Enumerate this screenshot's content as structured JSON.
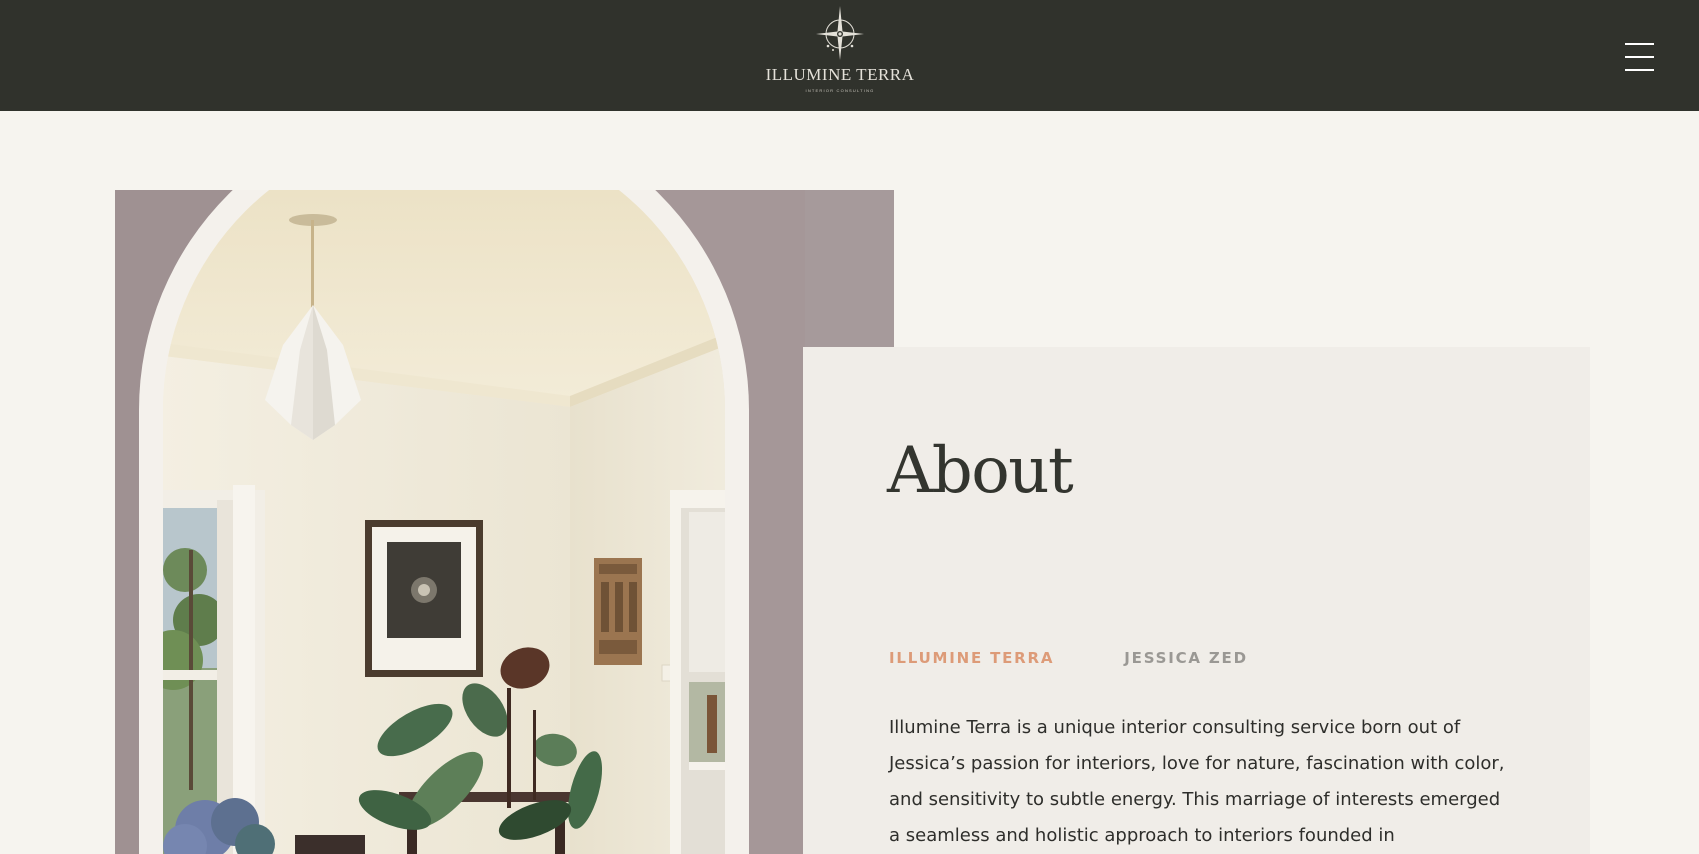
{
  "header": {
    "logo_name": "ILLUMINE TERRA",
    "logo_tagline": "INTERIOR CONSULTING",
    "menu_icon": "hamburger-icon"
  },
  "hero": {
    "image_subject": "arched doorway into a cream room with paper pendant lamp, framed art, wall carving and potted plant"
  },
  "about": {
    "title": "About",
    "tabs": [
      {
        "label": "ILLUMINE TERRA",
        "active": true
      },
      {
        "label": "JESSICA ZED",
        "active": false
      }
    ],
    "text": "Illumine Terra is a unique interior consulting service born out of Jessica’s passion for interiors, love for nature, fascination with color, and sensitivity to subtle energy. This marriage of interests emerged a seamless and holistic approach to interiors founded in"
  },
  "colors": {
    "header_bg": "#30322c",
    "page_bg": "#f6f4ef",
    "card_bg": "#f0ede8",
    "accent": "#dd9b78",
    "muted": "#9a9894",
    "text": "#2e2e2b"
  }
}
